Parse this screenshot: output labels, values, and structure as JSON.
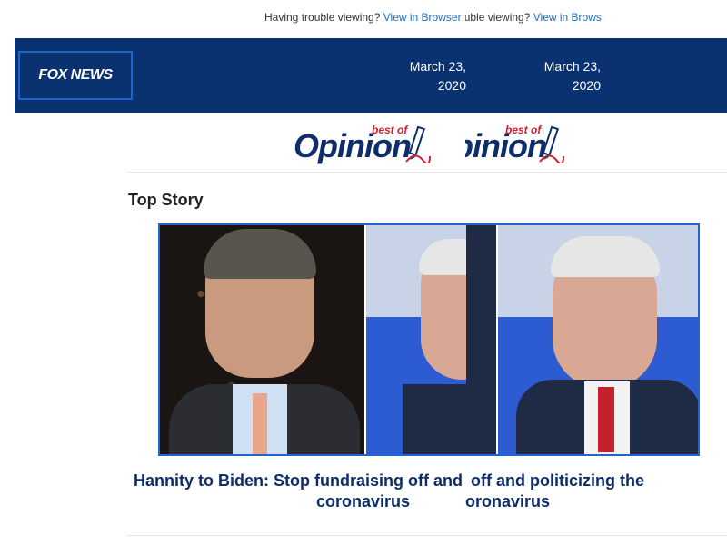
{
  "preheader": {
    "text": "Having trouble viewing?",
    "link_label": "View in Browser"
  },
  "header": {
    "logo_text": "FOX NEWS",
    "date_line1": "March 23,",
    "date_line2": "2020"
  },
  "opinion": {
    "best_of": "best of",
    "word": "Opinion"
  },
  "section": {
    "title": "Top Story"
  },
  "story": {
    "headline_line1": "Hannity to Biden: Stop fundraising off and politicizing the",
    "headline_line2": "coronavirus"
  },
  "colors": {
    "header_bg": "#0b3270",
    "accent_blue": "#1e66c9",
    "link_blue": "#1a6fc2",
    "headline_navy": "#0d2d6b",
    "opinion_red": "#d21f2f"
  },
  "icons": [
    "pen-icon"
  ]
}
